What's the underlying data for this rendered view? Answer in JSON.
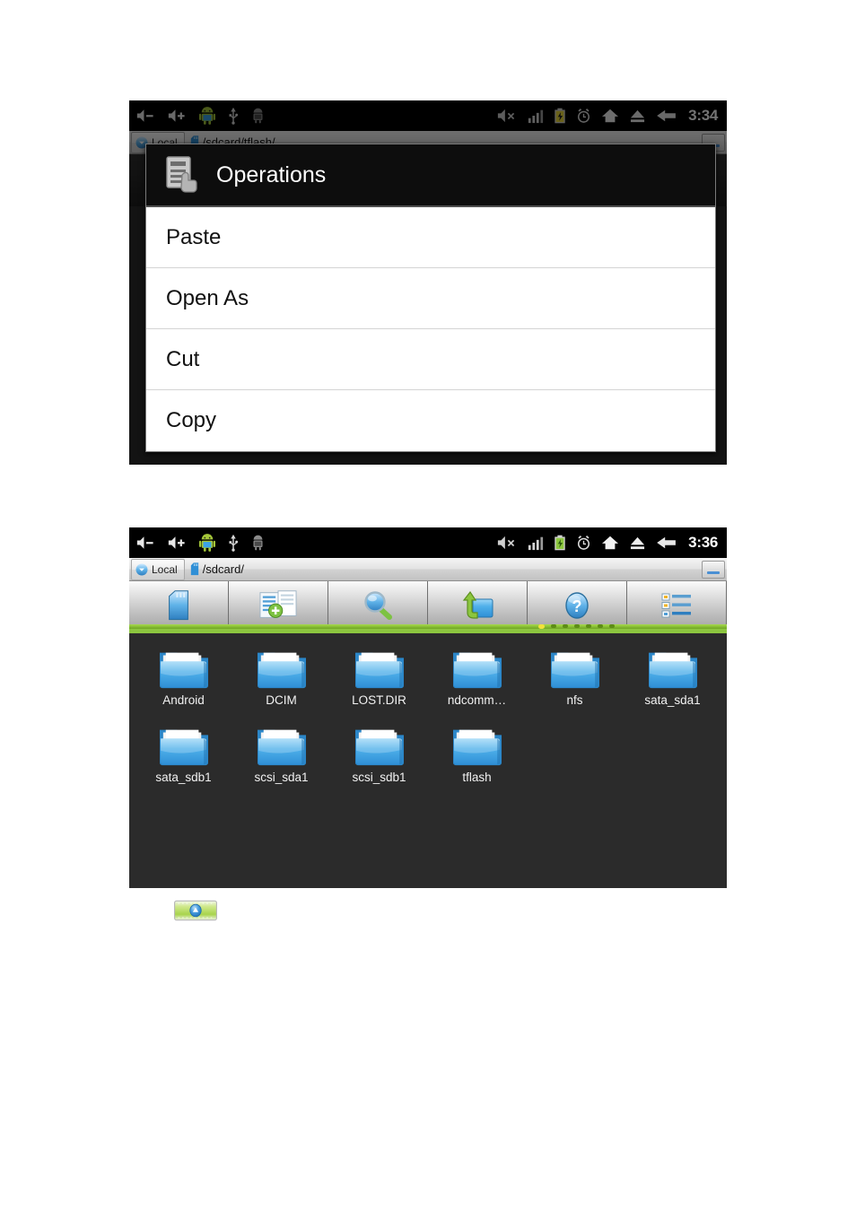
{
  "screenshot_one": {
    "statusbar": {
      "left_icons": [
        "volume-down-icon",
        "volume-up-icon",
        "android-robot-icon",
        "usb-icon",
        "adb-bug-icon"
      ],
      "right_icons": [
        "mute-icon",
        "signal-bars-icon",
        "battery-charging-icon",
        "alarm-clock-icon",
        "home-icon",
        "eject-icon",
        "back-arrow-icon"
      ],
      "time": "3:34",
      "battery_color": "#e8d83a"
    },
    "pathbar": {
      "local_label": "Local",
      "path": "/sdcard/tflash/"
    },
    "dialog": {
      "title": "Operations",
      "icon": "operations-hand-icon",
      "items": [
        {
          "label": "Paste"
        },
        {
          "label": "Open As"
        },
        {
          "label": "Cut"
        },
        {
          "label": "Copy"
        }
      ]
    }
  },
  "screenshot_two": {
    "statusbar": {
      "left_icons": [
        "volume-down-icon",
        "volume-up-icon",
        "android-robot-icon",
        "usb-icon",
        "adb-bug-icon"
      ],
      "right_icons": [
        "mute-icon",
        "signal-bars-icon",
        "battery-full-icon",
        "alarm-clock-icon",
        "home-icon",
        "eject-icon",
        "back-arrow-icon"
      ],
      "time": "3:36",
      "battery_color": "#8cc63f"
    },
    "pathbar": {
      "local_label": "Local",
      "path": "/sdcard/"
    },
    "toolbar": {
      "buttons": [
        {
          "name": "sdcard-icon",
          "label": ""
        },
        {
          "name": "new-file-icon",
          "label": ""
        },
        {
          "name": "search-icon",
          "label": ""
        },
        {
          "name": "up-folder-icon",
          "label": ""
        },
        {
          "name": "help-icon",
          "label": ""
        },
        {
          "name": "list-view-icon",
          "label": ""
        }
      ],
      "page_dots": 7,
      "active_dot": 0
    },
    "files": {
      "row1": [
        {
          "name": "Android"
        },
        {
          "name": "DCIM"
        },
        {
          "name": "LOST.DIR"
        },
        {
          "name": "ndcomm…"
        },
        {
          "name": "nfs"
        },
        {
          "name": "sata_sda1"
        }
      ],
      "row2": [
        {
          "name": "sata_sdb1"
        },
        {
          "name": "scsi_sda1"
        },
        {
          "name": "scsi_sdb1"
        },
        {
          "name": "tflash"
        }
      ]
    },
    "up_button": {
      "name": "scroll-up-button"
    }
  },
  "standalone": {
    "name": "scroll-up-button-thumbnail"
  },
  "colors": {
    "accent_green": "#8cc63f",
    "folder_blue": "#3ba3e8",
    "device_bg": "#2b2b2b",
    "statusbar_bg": "#000000"
  }
}
